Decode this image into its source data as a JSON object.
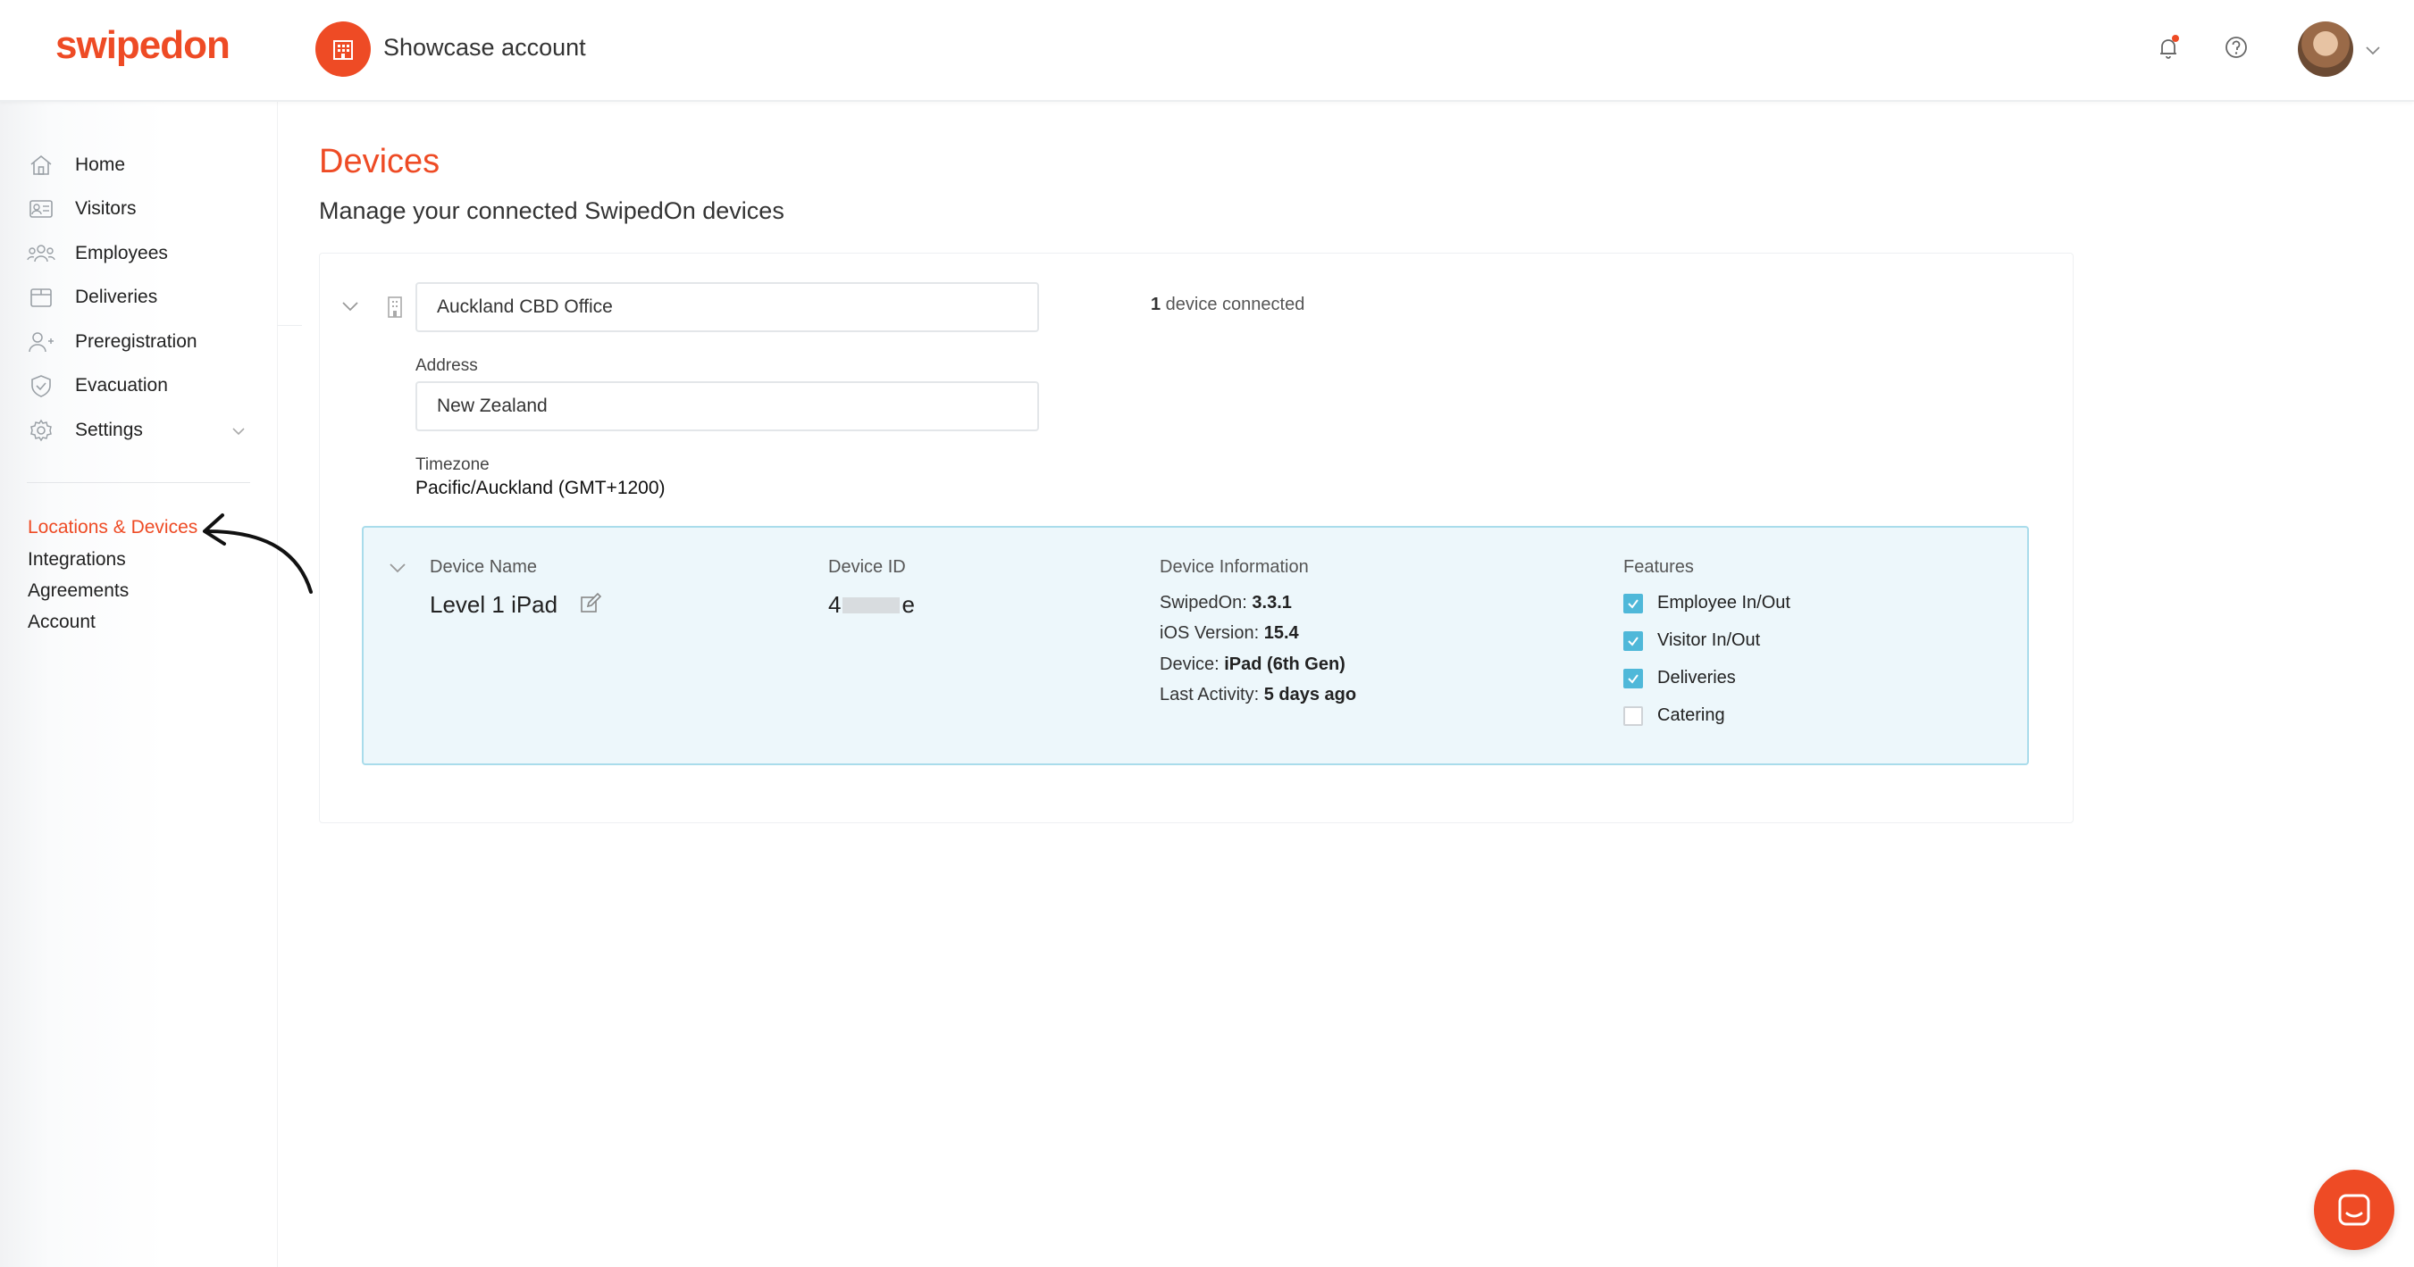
{
  "header": {
    "logo": "swipedon",
    "account_name": "Showcase account"
  },
  "sidebar": {
    "items": [
      {
        "label": "Home",
        "icon": "home-icon"
      },
      {
        "label": "Visitors",
        "icon": "visitors-icon"
      },
      {
        "label": "Employees",
        "icon": "employees-icon"
      },
      {
        "label": "Deliveries",
        "icon": "deliveries-icon"
      },
      {
        "label": "Preregistration",
        "icon": "preregistration-icon"
      },
      {
        "label": "Evacuation",
        "icon": "evacuation-icon"
      },
      {
        "label": "Settings",
        "icon": "gear-icon"
      }
    ],
    "sub_items": [
      {
        "label": "Locations & Devices",
        "active": true
      },
      {
        "label": "Integrations"
      },
      {
        "label": "Agreements"
      },
      {
        "label": "Account"
      }
    ]
  },
  "main": {
    "title": "Devices",
    "subtitle": "Manage your connected SwipedOn devices",
    "location": {
      "name": "Auckland CBD Office",
      "address_label": "Address",
      "address": "New Zealand",
      "timezone_label": "Timezone",
      "timezone": "Pacific/Auckland (GMT+1200)",
      "connected_count": "1",
      "connected_text": " device connected"
    },
    "device": {
      "name_label": "Device Name",
      "name": "Level 1 iPad",
      "id_label": "Device ID",
      "id_prefix": "4",
      "id_suffix": "e",
      "info_label": "Device Information",
      "info": [
        {
          "key": "SwipedOn: ",
          "value": "3.3.1"
        },
        {
          "key": "iOS Version: ",
          "value": "15.4"
        },
        {
          "key": "Device: ",
          "value": "iPad (6th Gen)"
        },
        {
          "key": "Last Activity: ",
          "value": "5 days ago"
        }
      ],
      "features_label": "Features",
      "features": [
        {
          "label": "Employee In/Out",
          "checked": true
        },
        {
          "label": "Visitor In/Out",
          "checked": true
        },
        {
          "label": "Deliveries",
          "checked": true
        },
        {
          "label": "Catering",
          "checked": false
        }
      ]
    }
  },
  "colors": {
    "brand": "#ee4b25",
    "checkbox": "#4fb8d9",
    "device_card_bg": "#edf7fb",
    "device_card_border": "#a9dceb"
  }
}
